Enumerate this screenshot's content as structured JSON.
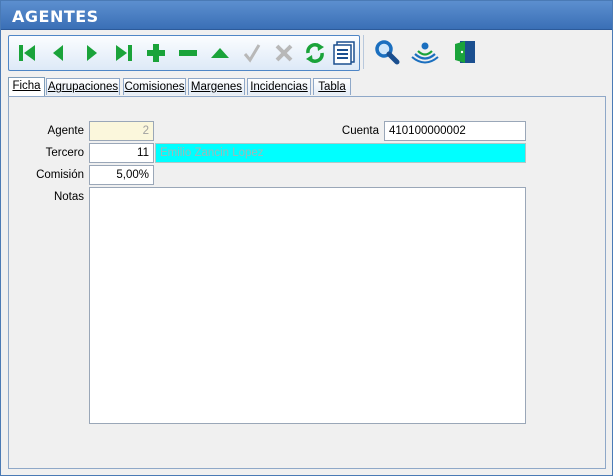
{
  "window": {
    "title": "AGENTES"
  },
  "toolbar": {
    "buttons": [
      {
        "name": "first-record",
        "icon": "skip-first-icon"
      },
      {
        "name": "prev-record",
        "icon": "arrow-left-icon"
      },
      {
        "name": "next-record",
        "icon": "arrow-right-icon"
      },
      {
        "name": "last-record",
        "icon": "skip-last-icon"
      },
      {
        "name": "add-record",
        "icon": "plus-icon"
      },
      {
        "name": "delete-record",
        "icon": "minus-icon"
      },
      {
        "name": "edit-record",
        "icon": "triangle-up-icon"
      },
      {
        "name": "confirm",
        "icon": "check-icon"
      },
      {
        "name": "cancel",
        "icon": "x-icon"
      },
      {
        "name": "refresh",
        "icon": "refresh-icon"
      },
      {
        "name": "list",
        "icon": "list-icon"
      }
    ],
    "extra": [
      {
        "name": "search",
        "icon": "magnifier-icon"
      },
      {
        "name": "wireless",
        "icon": "signal-icon"
      },
      {
        "name": "exit",
        "icon": "door-exit-icon"
      }
    ]
  },
  "tabs": [
    {
      "label": "Ficha",
      "active": true
    },
    {
      "label": "Agrupaciones",
      "active": false
    },
    {
      "label": "Comisiones",
      "active": false
    },
    {
      "label": "Margenes",
      "active": false
    },
    {
      "label": "Incidencias",
      "active": false
    },
    {
      "label": "Tabla",
      "active": false
    }
  ],
  "form": {
    "agente_label": "Agente",
    "agente_value": "2",
    "cuenta_label": "Cuenta",
    "cuenta_value": "410100000002",
    "tercero_label": "Tercero",
    "tercero_value": "11",
    "tercero_name": "Emilio Zancin Lopez",
    "comision_label": "Comisión",
    "comision_value": "5,00%",
    "notas_label": "Notas",
    "notas_value": ""
  },
  "colors": {
    "title_bar": "#3a6fb6",
    "icon_green": "#1aa33a",
    "icon_disabled": "#b8b8b8",
    "icon_blue": "#1b6fbf",
    "highlight_cyan": "#00ffff",
    "readonly_bg": "#fbf7dc"
  }
}
